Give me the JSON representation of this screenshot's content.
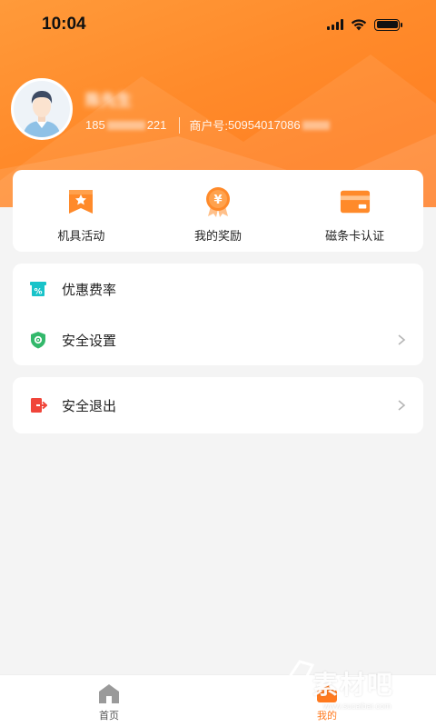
{
  "status_bar": {
    "time": "10:04"
  },
  "profile": {
    "name": "陈先生",
    "phone_prefix": "185",
    "phone_suffix": "221",
    "merchant_label": "商户号:",
    "merchant_number": "50954017086"
  },
  "quick_actions": [
    {
      "label": "机具活动",
      "icon": "activity-flag-icon"
    },
    {
      "label": "我的奖励",
      "icon": "reward-medal-icon"
    },
    {
      "label": "磁条卡认证",
      "icon": "card-icon"
    }
  ],
  "menu_group_1": [
    {
      "label": "优惠费率",
      "icon": "discount-rate-icon"
    },
    {
      "label": "安全设置",
      "icon": "shield-icon"
    }
  ],
  "menu_group_2": [
    {
      "label": "安全退出",
      "icon": "logout-icon"
    }
  ],
  "tab_bar": {
    "tabs": [
      {
        "label": "首页",
        "icon": "home-icon"
      },
      {
        "label": "我的",
        "icon": "profile-icon"
      }
    ],
    "active_index": 1
  },
  "watermark": {
    "main": "素材吧",
    "sub": "www.sucaibar.com"
  },
  "colors": {
    "brand": "#ff8a2a",
    "accent_orange": "#ff7a1f",
    "teal": "#19c3c9",
    "green": "#33b86b",
    "red": "#f0453a"
  }
}
